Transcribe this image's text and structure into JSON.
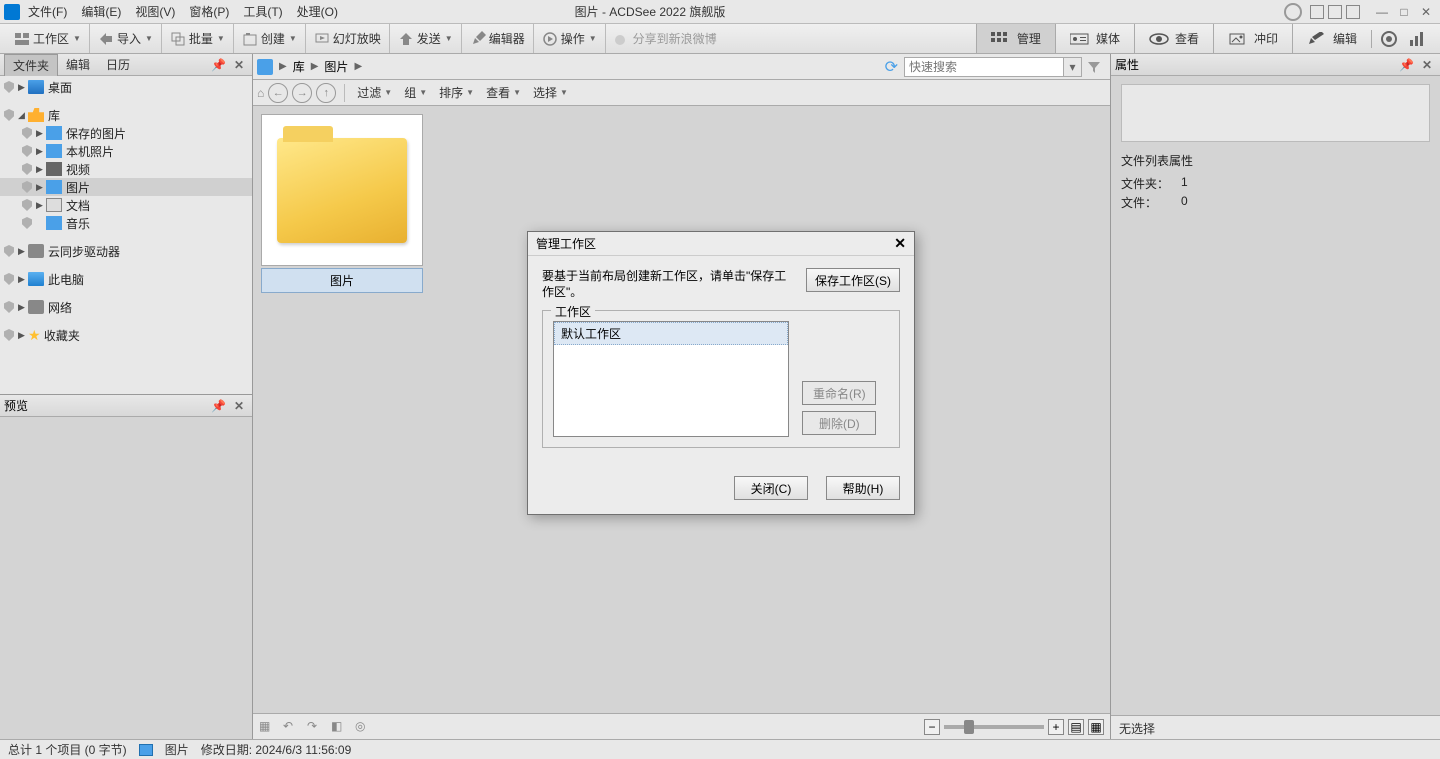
{
  "app": {
    "title": "图片 - ACDSee 2022 旗舰版"
  },
  "menu": {
    "file": "文件(F)",
    "edit": "编辑(E)",
    "view": "视图(V)",
    "window": "窗格(P)",
    "tools": "工具(T)",
    "process": "处理(O)"
  },
  "toolbar": {
    "workspace": "工作区",
    "import": "导入",
    "batch": "批量",
    "create": "创建",
    "slideshow": "幻灯放映",
    "send": "发送",
    "editor": "编辑器",
    "operate": "操作",
    "share_weibo": "分享到新浪微博"
  },
  "mode_tabs": {
    "manage": "管理",
    "media": "媒体",
    "view": "查看",
    "print": "冲印",
    "edit": "编辑"
  },
  "left_tabs": {
    "folders": "文件夹",
    "edit": "编辑",
    "calendar": "日历"
  },
  "tree": {
    "desktop": "桌面",
    "library": "库",
    "saved_pics": "保存的图片",
    "local_photos": "本机照片",
    "videos": "视频",
    "pictures": "图片",
    "documents": "文档",
    "music": "音乐",
    "cloud": "云同步驱动器",
    "this_pc": "此电脑",
    "network": "网络",
    "favorites": "收藏夹"
  },
  "preview_title": "预览",
  "breadcrumb": {
    "library": "库",
    "pictures": "图片"
  },
  "search": {
    "placeholder": "快速搜索"
  },
  "subbar": {
    "filter": "过滤",
    "group": "组",
    "sort": "排序",
    "view": "查看",
    "select": "选择"
  },
  "thumb": {
    "label": "图片"
  },
  "right": {
    "title": "属性",
    "section": "文件列表属性",
    "folders_label": "文件夹：",
    "folders_val": "1",
    "files_label": "文件：",
    "files_val": "0",
    "no_selection": "无选择"
  },
  "status": {
    "total": "总计 1 个项目 (0 字节)",
    "type": "图片",
    "modified": "修改日期: 2024/6/3 11:56:09"
  },
  "dialog": {
    "title": "管理工作区",
    "message": "要基于当前布局创建新工作区，请单击\"保存工作区\"。",
    "save": "保存工作区(S)",
    "group": "工作区",
    "default_item": "默认工作区",
    "rename": "重命名(R)",
    "delete": "删除(D)",
    "close": "关闭(C)",
    "help": "帮助(H)"
  }
}
